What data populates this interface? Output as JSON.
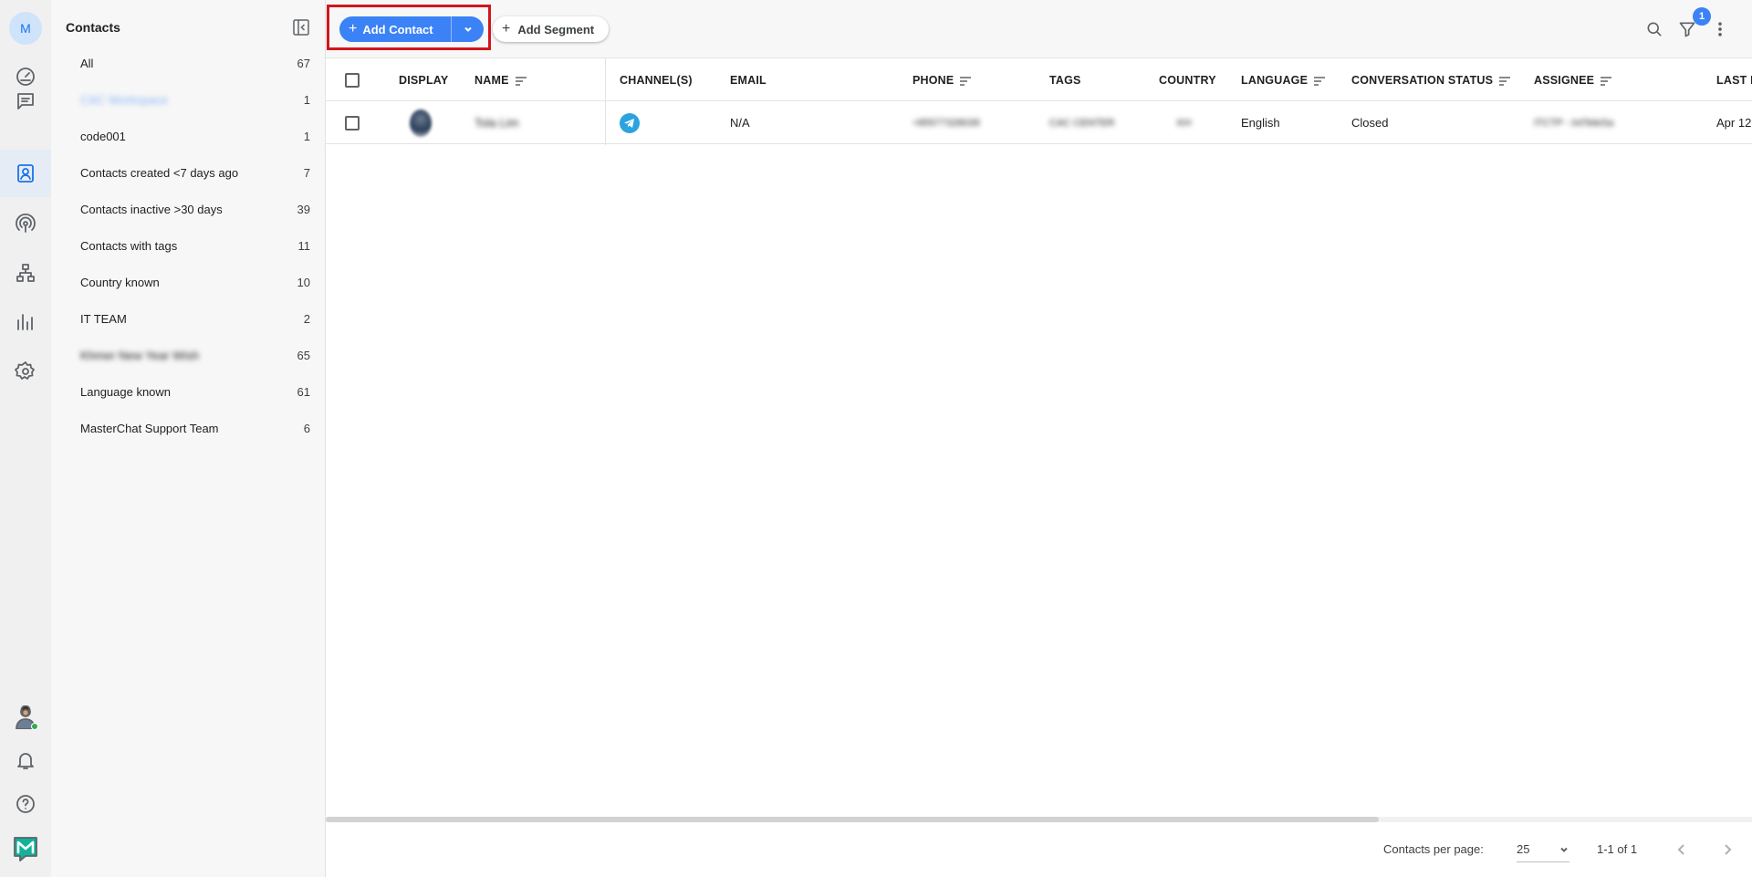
{
  "rail": {
    "workspace_initial": "M",
    "items": [
      {
        "icon": "dashboard-gauge-icon"
      },
      {
        "icon": "messages-icon"
      },
      {
        "icon": "contacts-icon",
        "active": true
      },
      {
        "icon": "broadcast-icon"
      },
      {
        "icon": "workflow-icon"
      },
      {
        "icon": "reports-bar-chart-icon"
      },
      {
        "icon": "settings-gear-icon"
      }
    ],
    "bottom": [
      "user-avatar",
      "bell-icon",
      "help-icon",
      "app-logo-icon"
    ],
    "accent_color": "#1a73e8"
  },
  "sidebar": {
    "title": "Contacts",
    "segments": [
      {
        "label": "All",
        "count": "67"
      },
      {
        "label": "CAC Workspace",
        "count": "1",
        "blurred": true
      },
      {
        "label": "code001",
        "count": "1"
      },
      {
        "label": "Contacts created <7 days ago",
        "count": "7"
      },
      {
        "label": "Contacts inactive >30 days",
        "count": "39"
      },
      {
        "label": "Contacts with tags",
        "count": "11"
      },
      {
        "label": "Country known",
        "count": "10"
      },
      {
        "label": "IT TEAM",
        "count": "2"
      },
      {
        "label": "Khmer New Year Wish",
        "count": "65",
        "blurred": true
      },
      {
        "label": "Language known",
        "count": "61"
      },
      {
        "label": "MasterChat Support Team",
        "count": "6"
      }
    ]
  },
  "toolbar": {
    "add_contact_label": "Add Contact",
    "add_segment_label": "Add Segment",
    "filter_badge": "1",
    "primary_color": "#3b82f6",
    "highlight_color": "#d0161d"
  },
  "table": {
    "headers": {
      "display": "DISPLAY",
      "name": "NAME",
      "channels": "CHANNEL(S)",
      "email": "EMAIL",
      "phone": "PHONE",
      "tags": "TAGS",
      "country": "COUNTRY",
      "language": "LANGUAGE",
      "conversation_status": "CONVERSATION STATUS",
      "assignee": "ASSIGNEE",
      "last": "LAST M"
    },
    "rows": [
      {
        "name": "Tola Lim",
        "channel": "telegram-icon",
        "email": "N/A",
        "phone": "+85577328039",
        "tags": "CAC CENTER",
        "country": "KH",
        "language": "English",
        "conversation_status": "Closed",
        "assignee": "ITCTP - IntTeleSa",
        "last": "Apr 12"
      }
    ]
  },
  "footer": {
    "per_page_label": "Contacts per page:",
    "per_page_value": "25",
    "range": "1-1 of 1"
  }
}
